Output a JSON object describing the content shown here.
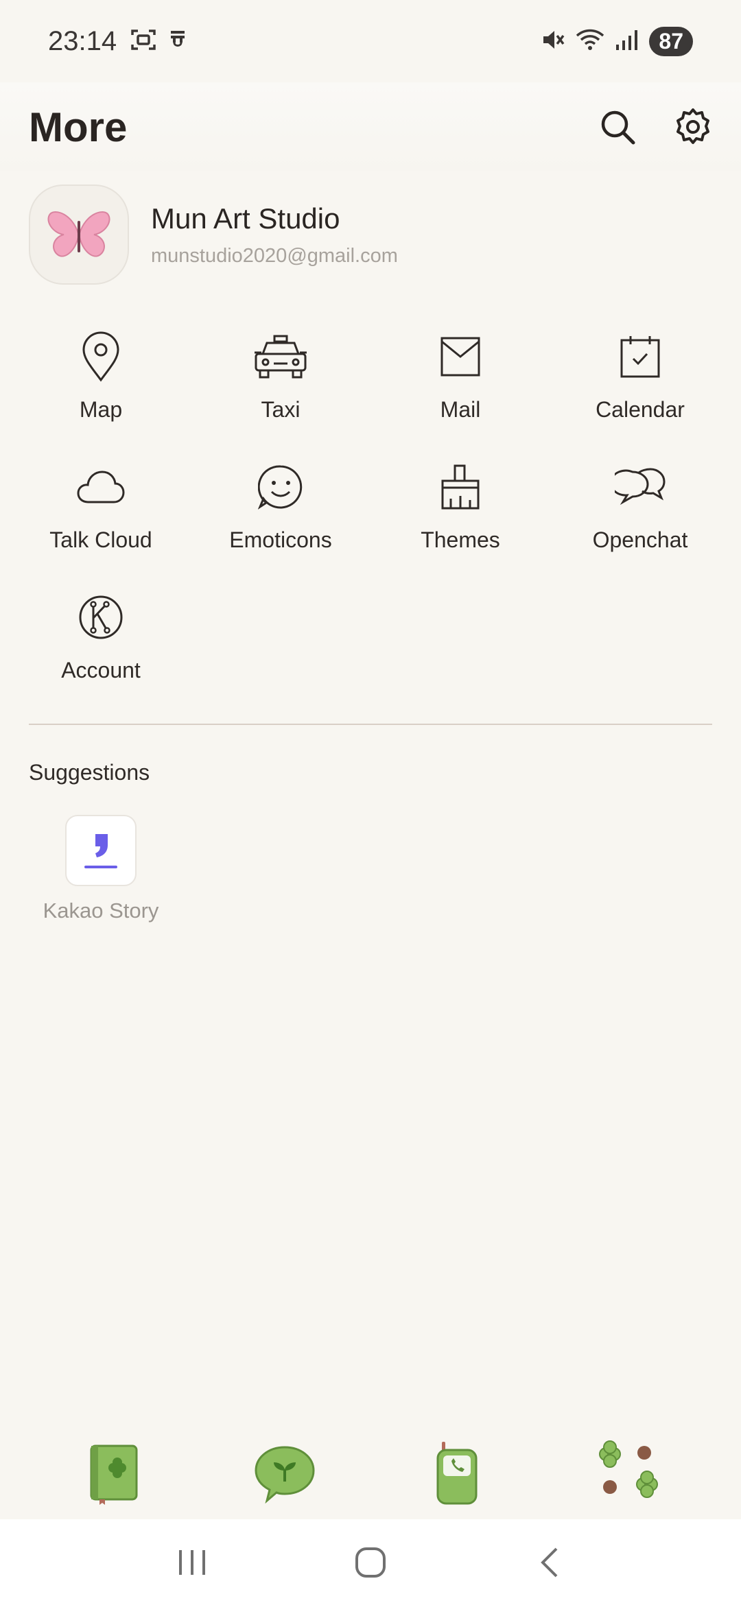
{
  "status": {
    "time": "23:14",
    "battery": "87",
    "icons": [
      "screenshot-icon",
      "notification-icon",
      "mute-icon",
      "wifi-icon",
      "signal-icon"
    ]
  },
  "header": {
    "title": "More",
    "actions": [
      "search-icon",
      "settings-icon"
    ]
  },
  "profile": {
    "name": "Mun Art Studio",
    "email": "munstudio2020@gmail.com",
    "avatar_icon": "butterfly-icon"
  },
  "menu": [
    {
      "label": "Map",
      "icon": "map-pin-icon"
    },
    {
      "label": "Taxi",
      "icon": "taxi-icon"
    },
    {
      "label": "Mail",
      "icon": "mail-icon"
    },
    {
      "label": "Calendar",
      "icon": "calendar-icon"
    },
    {
      "label": "Talk Cloud",
      "icon": "cloud-icon"
    },
    {
      "label": "Emoticons",
      "icon": "emoticon-icon"
    },
    {
      "label": "Themes",
      "icon": "paint-brush-icon"
    },
    {
      "label": "Openchat",
      "icon": "chat-bubbles-icon"
    },
    {
      "label": "Account",
      "icon": "kakao-account-icon"
    }
  ],
  "suggestions": {
    "title": "Suggestions",
    "items": [
      {
        "label": "Kakao Story",
        "icon": "kakao-story-icon"
      }
    ]
  },
  "tabbar": {
    "items": [
      "friends-tab-icon",
      "chats-tab-icon",
      "calls-tab-icon",
      "more-tab-icon"
    ]
  },
  "colors": {
    "background": "#f8f6f1",
    "accent_green": "#8bbd5c",
    "kakao_story_purple": "#6a5ee8"
  }
}
